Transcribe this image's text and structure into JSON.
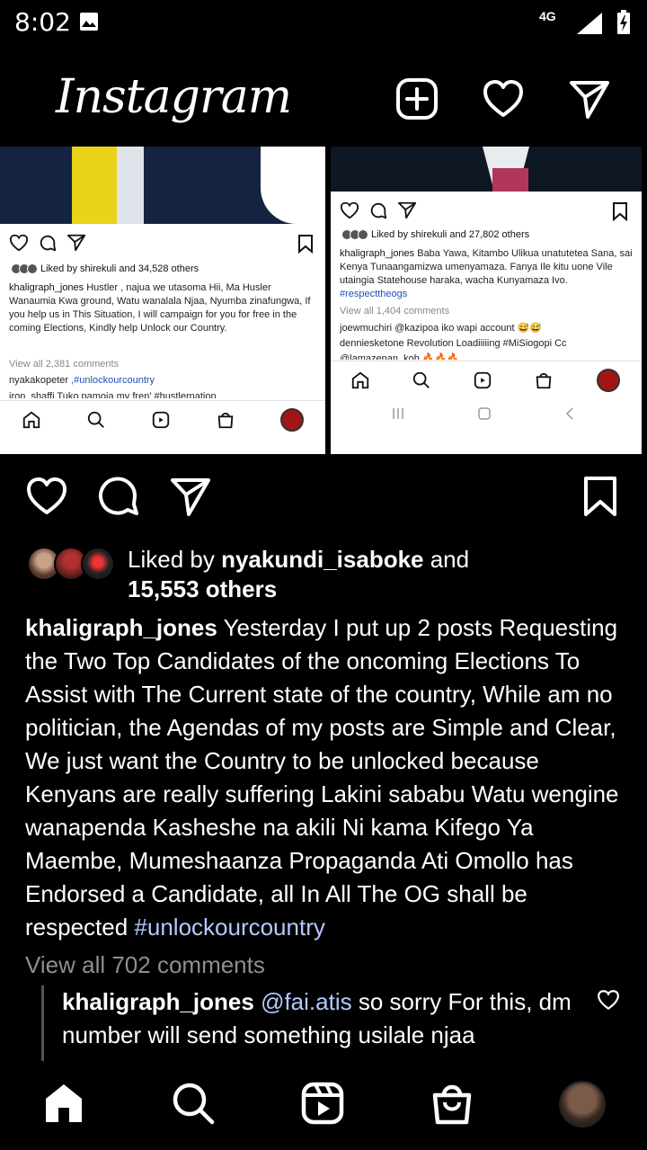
{
  "status_bar": {
    "time": "8:02",
    "network": "4G",
    "icons": [
      "image-icon",
      "signal-icon",
      "battery-icon"
    ]
  },
  "header": {
    "title": "Instagram",
    "icons": [
      "add-post-icon",
      "heart-icon",
      "direct-message-icon"
    ]
  },
  "embedded_left": {
    "liked_by": "Liked by shirekuli and 34,528 others",
    "caption_user": "khaligraph_jones",
    "caption": " Hustler , najua we utasoma Hii,  Ma Husler Wanaumia Kwa ground, Watu wanalala Njaa, Nyumba zinafungwa, If you help us in This Situation, I will campaign for you for free in the coming Elections, Kindly help Unlock our Country.",
    "view_all": "View all 2,381 comments",
    "comment1_user": "nyakakopeter",
    "comment1_text": " ,#unlockourcountry",
    "comment2": "iron_shaffi Tuko pamoja my fren' #hustlernation"
  },
  "embedded_right": {
    "liked_by": "Liked by shirekuli and 27,802 others",
    "caption_user": "khaligraph_jones",
    "caption": " Baba Yawa,  Kitambo Ulikua unatutetea Sana, sai Kenya Tunaangamizwa umenyamaza. Fanya Ile kitu uone Vile utaingia Statehouse haraka, wacha Kunyamaza Ivo.",
    "caption_tag": "#respecttheogs",
    "view_all": "View all 1,404 comments",
    "comment1_user": "joewmuchiri",
    "comment1_text": " @kazipoa iko wapi account 😅😅",
    "comment2_user": "denniesketone",
    "comment2_text": " Revolution Loadiiiiing #MiSiogopi Cc",
    "comment3": "@lamazenan_koh 🔥🔥🔥"
  },
  "post": {
    "liked_prefix": "Liked by ",
    "liked_user": "nyakundi_isaboke",
    "liked_and": " and",
    "liked_others": "15,553 others",
    "caption_user": "khaligraph_jones",
    "caption_text": " Yesterday  I put up 2 posts Requesting the Two Top Candidates of the oncoming Elections To Assist with The Current state of the country, While am no politician, the Agendas of my posts are Simple and Clear, We just want the Country to be unlocked because Kenyans are really suffering Lakini  sababu Watu wengine wanapenda Kasheshe na akili Ni kama Kifego Ya Maembe,  Mumeshaanza Propaganda Ati Omollo has Endorsed a Candidate, all In All The OG shall be respected ",
    "caption_tag": "#unlockourcountry",
    "view_all": "View all 702 comments",
    "comment_user": "khaligraph_jones",
    "comment_mention": " @fai.atis",
    "comment_text": " so sorry For this, dm number will send something usilale njaa"
  },
  "bottom_nav": {
    "items": [
      "home-icon",
      "search-icon",
      "reels-icon",
      "shop-icon",
      "profile-avatar"
    ]
  },
  "colors": {
    "background": "#000000",
    "text": "#ffffff",
    "muted": "#8e8e8e",
    "link": "#b5c9ff"
  }
}
